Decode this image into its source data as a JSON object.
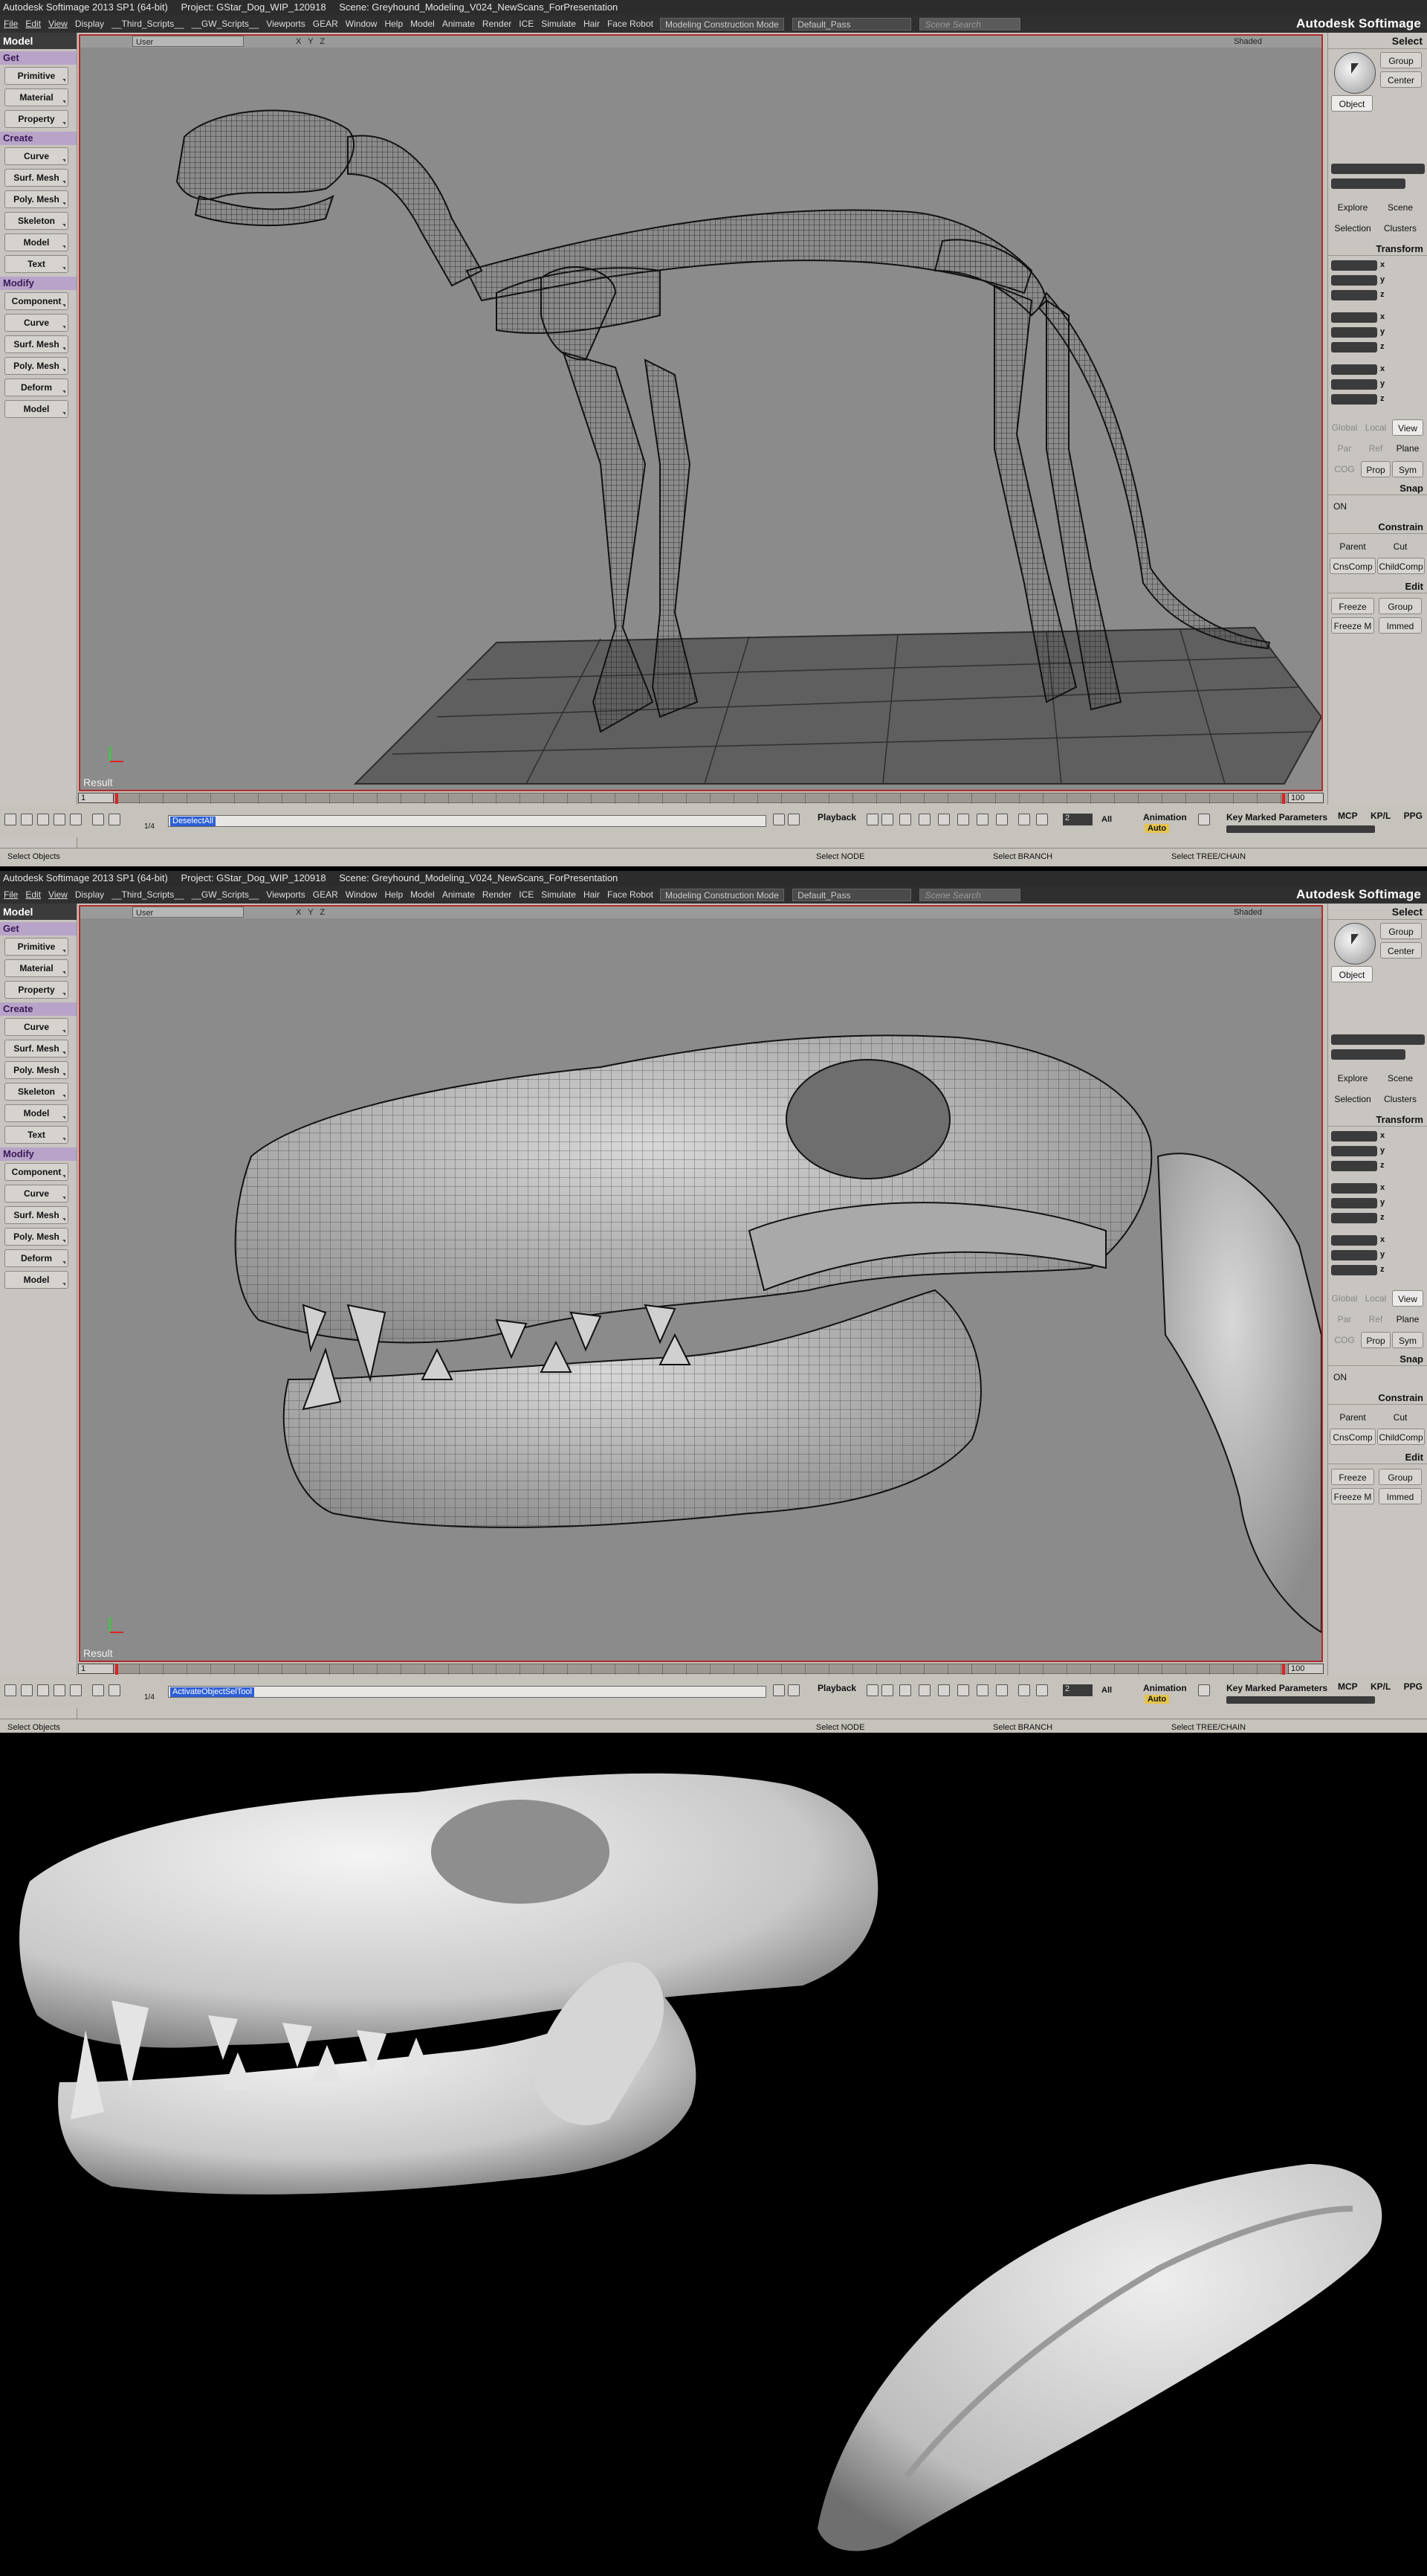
{
  "windows": [
    {
      "title": {
        "app": "Autodesk Softimage 2013 SP1 (64-bit)",
        "project": "Project: GStar_Dog_WIP_120918",
        "scene": "Scene: Greyhound_Modeling_V024_NewScans_ForPresentation"
      },
      "brand": "Autodesk Softimage",
      "menus": [
        "File",
        "Edit",
        "View",
        "Display",
        "__Third_Scripts__",
        "__GW_Scripts__",
        "Viewports",
        "GEAR",
        "Window",
        "Help",
        "Model",
        "Animate",
        "Render",
        "ICE",
        "Simulate",
        "Hair",
        "Face Robot"
      ],
      "mode": "Modeling Construction Mode",
      "pass": "Default_Pass",
      "search_placeholder": "Scene Search",
      "viewport": {
        "camera": "User",
        "axes": "X Y Z",
        "shading": "Shaded",
        "label": "Result"
      },
      "command": "DeselectAll",
      "frame_start": "1",
      "frame_end": "100",
      "frame_current": "1"
    },
    {
      "title": {
        "app": "Autodesk Softimage 2013 SP1 (64-bit)",
        "project": "Project: GStar_Dog_WIP_120918",
        "scene": "Scene: Greyhound_Modeling_V024_NewScans_ForPresentation"
      },
      "brand": "Autodesk Softimage",
      "menus": [
        "File",
        "Edit",
        "View",
        "Display",
        "__Third_Scripts__",
        "__GW_Scripts__",
        "Viewports",
        "GEAR",
        "Window",
        "Help",
        "Model",
        "Animate",
        "Render",
        "ICE",
        "Simulate",
        "Hair",
        "Face Robot"
      ],
      "mode": "Modeling Construction Mode",
      "pass": "Default_Pass",
      "search_placeholder": "Scene Search",
      "viewport": {
        "camera": "User",
        "axes": "X Y Z",
        "shading": "Shaded",
        "label": "Result"
      },
      "command": "ActivateObjectSelTool",
      "frame_start": "1",
      "frame_end": "100",
      "frame_current": "1"
    }
  ],
  "left_panel": {
    "header": "Model",
    "sections": [
      {
        "title": "Get",
        "buttons": [
          "Primitive",
          "Material",
          "Property"
        ]
      },
      {
        "title": "Create",
        "buttons": [
          "Curve",
          "Surf. Mesh",
          "Poly. Mesh",
          "Skeleton",
          "Model",
          "Text"
        ]
      },
      {
        "title": "Modify",
        "buttons": [
          "Component",
          "Curve",
          "Surf. Mesh",
          "Poly. Mesh",
          "Deform",
          "Model"
        ]
      }
    ]
  },
  "right_panel": {
    "header": "Select",
    "group": "Group",
    "center": "Center",
    "object": "Object",
    "explore": "Explore",
    "scene": "Scene",
    "selection": "Selection",
    "clusters": "Clusters",
    "transform": "Transform",
    "axes": [
      "x",
      "y",
      "z"
    ],
    "global": "Global",
    "local": "Local",
    "view": "View",
    "par": "Par",
    "ref": "Ref",
    "plane": "Plane",
    "cog": "COG",
    "prop": "Prop",
    "sym": "Sym",
    "snap": "Snap",
    "on": "ON",
    "constrain": "Constrain",
    "parent": "Parent",
    "cut": "Cut",
    "cnscomp": "CnsComp",
    "childcomp": "ChildComp",
    "edit": "Edit",
    "freeze": "Freeze",
    "group2": "Group",
    "freezem": "Freeze M",
    "immed": "Immed"
  },
  "toolbar": {
    "playback": "Playback",
    "animation": "Animation",
    "auto": "Auto",
    "key_marked": "Key Marked Parameters",
    "all": "All",
    "step": "2",
    "page": "1/4",
    "tabs": [
      "MCP",
      "KP/L",
      "PPG"
    ]
  },
  "status": {
    "left": "Select Objects",
    "mid1": "Select NODE",
    "mid2": "Select BRANCH",
    "mid3": "Select TREE/CHAIN"
  },
  "colors": {
    "accent": "#b12a2a",
    "section": "#b8a4c8",
    "viewport": "#8b8b8b"
  }
}
